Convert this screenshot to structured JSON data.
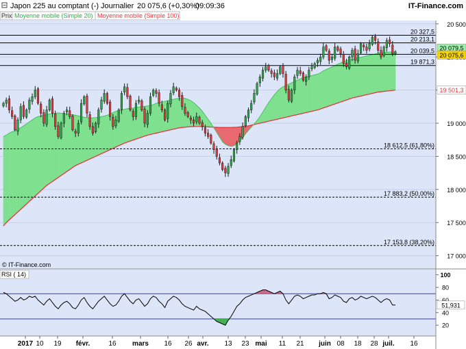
{
  "header": {
    "title": "Japon 225 au comptant (-)",
    "period": "Journalier",
    "last": "20 075,6 (+0,30%)",
    "time": "09:09:36",
    "brand": "IT-Finance.com"
  },
  "legend": {
    "price_label": "Prix",
    "ma20_label": "Moyenne mobile (Simple 20)",
    "ma100_label": "Moyenne mobile (Simple 100)"
  },
  "watermark": "© IT-Finance.com",
  "rsi_label": "RSI ( 14)",
  "colors": {
    "background": "#dce6f8",
    "up": "#2ea84a",
    "down": "#e0393e",
    "ma_fill_up": "#7fe08f",
    "ma_fill_down": "#e86a70",
    "ma100": "#e0393e",
    "last_badge": "#f5d400",
    "ma20_badge": "#9ff0a8",
    "ma100_badge": "#ffffff"
  },
  "chart_data": {
    "type": "candlestick",
    "ylim": [
      16800,
      20550
    ],
    "yticks": [
      17000,
      17500,
      18000,
      18500,
      19000,
      19500,
      20000,
      20500
    ],
    "ytick_labels": [
      "17 000",
      "17 500",
      "18 000",
      "18 500",
      "19 000",
      "19 500",
      "20 000",
      "20 500"
    ],
    "xticks": [
      {
        "label": "2017",
        "bold": true
      },
      {
        "label": "10"
      },
      {
        "label": "19"
      },
      {
        "label": "févr.",
        "bold": true
      },
      {
        "label": "16"
      },
      {
        "label": "mars",
        "bold": true
      },
      {
        "label": "16"
      },
      {
        "label": "26"
      },
      {
        "label": "avr.",
        "bold": true
      },
      {
        "label": "13"
      },
      {
        "label": "23"
      },
      {
        "label": "mai",
        "bold": true
      },
      {
        "label": "11"
      },
      {
        "label": "21"
      },
      {
        "label": "juin",
        "bold": true
      },
      {
        "label": "08"
      },
      {
        "label": "18"
      },
      {
        "label": "28"
      },
      {
        "label": "juil.",
        "bold": true
      },
      {
        "label": "16"
      }
    ],
    "hlines": [
      {
        "value": 20327.5,
        "label": "20 327,5",
        "style": "solid"
      },
      {
        "value": 20213.1,
        "label": "20 213,1",
        "style": "solid"
      },
      {
        "value": 20039.5,
        "label": "20 039,5",
        "style": "solid"
      },
      {
        "value": 19871.3,
        "label": "19 871,3",
        "style": "solid"
      },
      {
        "value": 18612.5,
        "label": "18 612,5 (61,80%)",
        "style": "dashed"
      },
      {
        "value": 17883.2,
        "label": "17 883,2 (50,00%)",
        "style": "dashed"
      },
      {
        "value": 17153.8,
        "label": "17 153,8 (38,20%)",
        "style": "dashed"
      }
    ],
    "last_price": {
      "value": 20075.6,
      "label": "20 075,6"
    },
    "ma20_last": {
      "value": 20079.5,
      "label": "20 079,5"
    },
    "ma100_last": {
      "value": 19501.3,
      "label": "19 501,3"
    },
    "closes": [
      19300,
      19350,
      19200,
      19100,
      18900,
      19050,
      19250,
      19100,
      19200,
      19350,
      19400,
      19500,
      19300,
      19150,
      19000,
      19200,
      19350,
      19150,
      18950,
      18800,
      19000,
      19150,
      19200,
      19100,
      18900,
      18850,
      19000,
      19300,
      19400,
      19150,
      18950,
      18850,
      19000,
      19200,
      19350,
      19450,
      19300,
      19100,
      18950,
      19050,
      19200,
      19450,
      19550,
      19400,
      19200,
      19100,
      19300,
      19350,
      19200,
      19000,
      19150,
      19400,
      19500,
      19450,
      19300,
      19200,
      19050,
      19300,
      19450,
      19550,
      19500,
      19400,
      19250,
      19150,
      19100,
      19050,
      19000,
      19100,
      19000,
      18950,
      18850,
      18800,
      18700,
      18600,
      18500,
      18400,
      18300,
      18250,
      18350,
      18450,
      18600,
      18700,
      18800,
      18950,
      19100,
      19200,
      19300,
      19450,
      19600,
      19700,
      19800,
      19850,
      19800,
      19750,
      19700,
      19750,
      19850,
      19750,
      19500,
      19350,
      19500,
      19700,
      19800,
      19750,
      19650,
      19700,
      19800,
      19850,
      19900,
      19950,
      20000,
      20150,
      20100,
      19950,
      20000,
      20150,
      20100,
      20050,
      19900,
      19850,
      20000,
      20100,
      19950,
      20050,
      20200,
      20150,
      20100,
      20200,
      20300,
      20250,
      20100,
      20000,
      20150,
      20250,
      20200,
      20050,
      20076
    ],
    "ma20": [
      18800,
      18820,
      18850,
      18870,
      18890,
      18910,
      18930,
      18960,
      18990,
      19020,
      19050,
      19080,
      19100,
      19110,
      19120,
      19130,
      19140,
      19145,
      19150,
      19155,
      19150,
      19145,
      19140,
      19135,
      19130,
      19120,
      19110,
      19100,
      19090,
      19085,
      19080,
      19080,
      19085,
      19090,
      19100,
      19110,
      19120,
      19140,
      19160,
      19180,
      19190,
      19200,
      19210,
      19220,
      19225,
      19230,
      19240,
      19245,
      19250,
      19255,
      19260,
      19270,
      19280,
      19300,
      19310,
      19320,
      19330,
      19340,
      19350,
      19360,
      19370,
      19375,
      19380,
      19375,
      19360,
      19340,
      19310,
      19270,
      19230,
      19180,
      19120,
      19060,
      19000,
      18930,
      18860,
      18790,
      18720,
      18680,
      18660,
      18650,
      18660,
      18690,
      18730,
      18780,
      18840,
      18890,
      18940,
      18990,
      19040,
      19100,
      19170,
      19240,
      19310,
      19370,
      19430,
      19480,
      19520,
      19550,
      19570,
      19590,
      19610,
      19630,
      19650,
      19670,
      19690,
      19700,
      19710,
      19720,
      19730,
      19740,
      19760,
      19790,
      19810,
      19830,
      19850,
      19870,
      19890,
      19910,
      19930,
      19945,
      19955,
      19965,
      19975,
      19985,
      19995,
      20005,
      20015,
      20025,
      20035,
      20045,
      20055,
      20060,
      20065,
      20070,
      20075,
      20078,
      20079.5
    ],
    "ma100": [
      17450,
      17500,
      17540,
      17580,
      17620,
      17660,
      17700,
      17740,
      17780,
      17820,
      17860,
      17900,
      17940,
      17980,
      18020,
      18060,
      18090,
      18120,
      18150,
      18180,
      18210,
      18240,
      18270,
      18300,
      18330,
      18360,
      18380,
      18400,
      18420,
      18440,
      18460,
      18480,
      18500,
      18520,
      18540,
      18560,
      18580,
      18600,
      18620,
      18640,
      18660,
      18680,
      18700,
      18715,
      18730,
      18745,
      18760,
      18775,
      18790,
      18805,
      18820,
      18830,
      18840,
      18850,
      18860,
      18870,
      18880,
      18890,
      18900,
      18910,
      18920,
      18930,
      18935,
      18940,
      18945,
      18948,
      18950,
      18950,
      18950,
      18948,
      18946,
      18944,
      18942,
      18940,
      18938,
      18936,
      18935,
      18935,
      18935,
      18936,
      18938,
      18940,
      18945,
      18950,
      18955,
      18960,
      18970,
      18980,
      18990,
      19000,
      19010,
      19020,
      19030,
      19040,
      19050,
      19060,
      19070,
      19080,
      19090,
      19100,
      19110,
      19120,
      19130,
      19140,
      19150,
      19160,
      19170,
      19180,
      19190,
      19200,
      19215,
      19230,
      19245,
      19260,
      19275,
      19290,
      19305,
      19320,
      19335,
      19350,
      19365,
      19380,
      19390,
      19400,
      19410,
      19420,
      19430,
      19440,
      19450,
      19460,
      19470,
      19475,
      19480,
      19485,
      19490,
      19495,
      19501.3
    ],
    "rsi": {
      "ylim": [
        0,
        100
      ],
      "yticks": [
        20,
        40,
        60,
        80,
        100
      ],
      "ytick_labels": [
        "20",
        "40",
        "60",
        "80",
        "100"
      ],
      "levels": [
        30,
        70
      ],
      "last": {
        "value": 51.931,
        "label": "51,931"
      },
      "values": [
        72,
        70,
        66,
        62,
        58,
        60,
        64,
        60,
        62,
        66,
        64,
        66,
        60,
        56,
        52,
        58,
        62,
        56,
        50,
        46,
        52,
        56,
        58,
        54,
        48,
        46,
        52,
        60,
        64,
        56,
        50,
        46,
        52,
        58,
        62,
        66,
        60,
        54,
        50,
        52,
        58,
        66,
        70,
        64,
        58,
        54,
        60,
        62,
        56,
        50,
        54,
        62,
        66,
        64,
        58,
        54,
        48,
        58,
        62,
        66,
        64,
        60,
        54,
        50,
        48,
        46,
        44,
        50,
        46,
        44,
        42,
        38,
        34,
        30,
        26,
        24,
        22,
        20,
        28,
        34,
        42,
        50,
        54,
        60,
        64,
        66,
        68,
        70,
        72,
        74,
        76,
        76,
        74,
        72,
        70,
        72,
        74,
        70,
        60,
        54,
        60,
        66,
        68,
        66,
        62,
        64,
        66,
        68,
        68,
        70,
        70,
        72,
        70,
        62,
        64,
        68,
        66,
        64,
        58,
        56,
        62,
        64,
        60,
        62,
        66,
        64,
        62,
        64,
        66,
        64,
        60,
        56,
        60,
        62,
        60,
        52,
        52
      ]
    }
  }
}
